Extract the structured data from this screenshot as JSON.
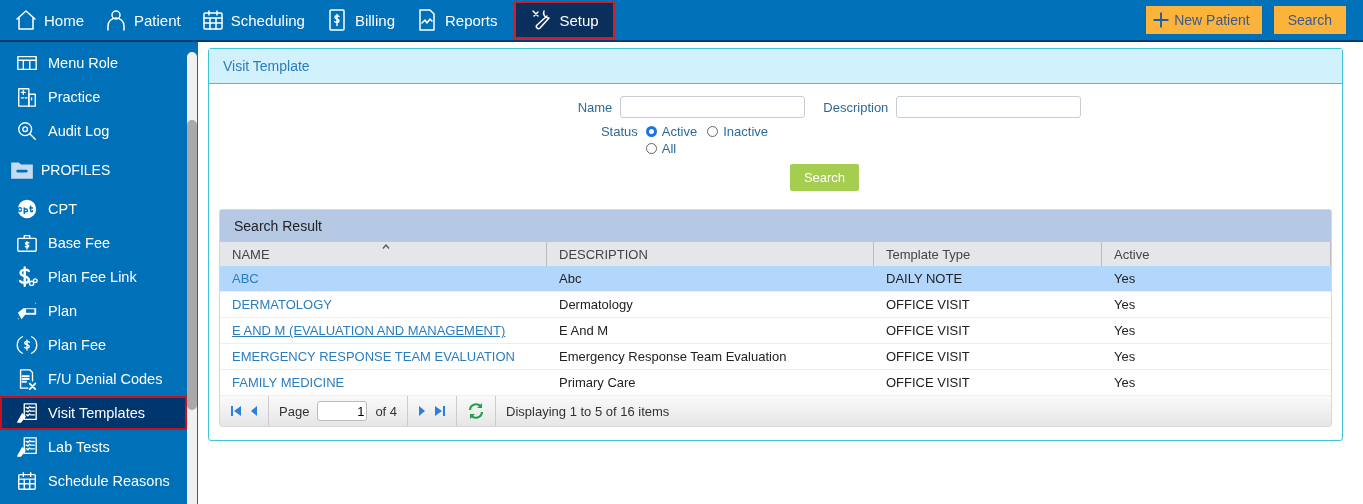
{
  "nav": [
    {
      "label": "Home",
      "selected": false
    },
    {
      "label": "Patient",
      "selected": false
    },
    {
      "label": "Scheduling",
      "selected": false
    },
    {
      "label": "Billing",
      "selected": false
    },
    {
      "label": "Reports",
      "selected": false
    },
    {
      "label": "Setup",
      "selected": true
    }
  ],
  "header_buttons": [
    "New Patient",
    "Search"
  ],
  "sidebar": {
    "items": [
      {
        "label": "Menu Role",
        "kind": "item",
        "selected": false
      },
      {
        "label": "Practice",
        "kind": "item",
        "selected": false
      },
      {
        "label": "Audit Log",
        "kind": "item",
        "selected": false
      },
      {
        "label": "PROFILES",
        "kind": "section"
      },
      {
        "label": "CPT",
        "kind": "item",
        "selected": false
      },
      {
        "label": "Base Fee",
        "kind": "item",
        "selected": false
      },
      {
        "label": "Plan Fee Link",
        "kind": "item",
        "selected": false
      },
      {
        "label": "Plan",
        "kind": "item",
        "selected": false
      },
      {
        "label": "Plan Fee",
        "kind": "item",
        "selected": false
      },
      {
        "label": "F/U Denial Codes",
        "kind": "item",
        "selected": false
      },
      {
        "label": "Visit Templates",
        "kind": "item",
        "selected": true
      },
      {
        "label": "Lab Tests",
        "kind": "item",
        "selected": false
      },
      {
        "label": "Schedule Reasons",
        "kind": "item",
        "selected": false
      }
    ]
  },
  "panel": {
    "title": "Visit Template",
    "form": {
      "name_label": "Name",
      "description_label": "Description",
      "status_label": "Status",
      "status_options": [
        {
          "label": "Active",
          "selected": true
        },
        {
          "label": "Inactive",
          "selected": false
        },
        {
          "label": "All",
          "selected": false
        }
      ],
      "search_button": "Search"
    },
    "results": {
      "title": "Search Result",
      "columns": [
        {
          "label": "NAME",
          "sorted": true
        },
        {
          "label": "DESCRIPTION",
          "sorted": false
        },
        {
          "label": "Template Type",
          "sorted": false
        },
        {
          "label": "Active",
          "sorted": false
        }
      ],
      "rows": [
        {
          "name": "ABC",
          "description": "Abc",
          "template_type": "DAILY NOTE",
          "active": "Yes",
          "selected": true,
          "hovered": false
        },
        {
          "name": "DERMATOLOGY",
          "description": "Dermatology",
          "template_type": "OFFICE VISIT",
          "active": "Yes",
          "selected": false,
          "hovered": false
        },
        {
          "name": "E AND M (EVALUATION AND MANAGEMENT)",
          "description": "E And M",
          "template_type": "OFFICE VISIT",
          "active": "Yes",
          "selected": false,
          "hovered": true
        },
        {
          "name": "EMERGENCY RESPONSE TEAM EVALUATION",
          "description": "Emergency Response Team Evaluation",
          "template_type": "OFFICE VISIT",
          "active": "Yes",
          "selected": false,
          "hovered": false
        },
        {
          "name": "FAMILY MEDICINE",
          "description": "Primary Care",
          "template_type": "OFFICE VISIT",
          "active": "Yes",
          "selected": false,
          "hovered": false
        }
      ],
      "pager": {
        "page_label": "Page",
        "page": "1",
        "of_label": "of 4",
        "summary": "Displaying 1 to 5 of 16 items"
      }
    }
  }
}
